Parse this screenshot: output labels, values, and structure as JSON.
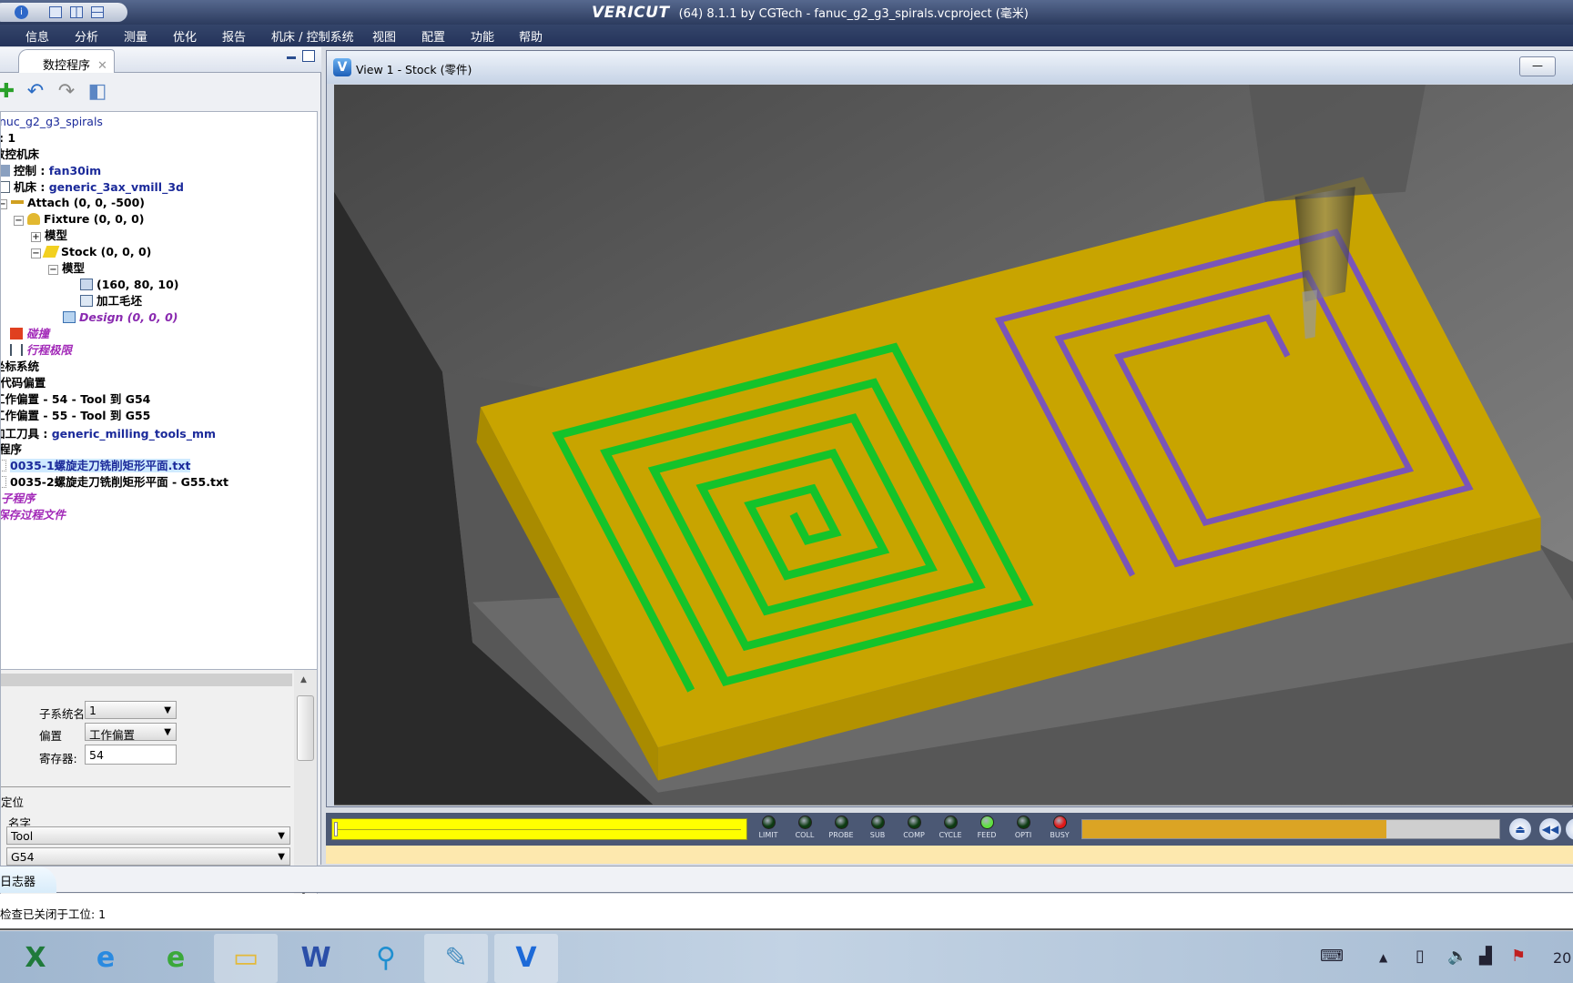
{
  "titlebar": {
    "logo": "VERICUT",
    "text": "(64)  8.1.1 by CGTech - fanuc_g2_g3_spirals.vcproject (毫米)"
  },
  "menu": [
    "信息",
    "分析",
    "测量",
    "优化",
    "报告",
    "机床 / 控制系统",
    "视图",
    "配置",
    "功能",
    "帮助"
  ],
  "left_panel": {
    "tab_label": "数控程序",
    "close_glyph": "✕",
    "tree": [
      {
        "text": "nuc_g2_g3_spirals",
        "style": "blue-plain"
      },
      {
        "text": ": 1"
      },
      {
        "text": "数控机床"
      },
      {
        "label": "控制 : ",
        "value": "fan30im"
      },
      {
        "label": "机床 : ",
        "value": "generic_3ax_vmill_3d"
      },
      {
        "text": "Attach (0, 0, -500)"
      },
      {
        "text": "Fixture (0, 0, 0)"
      },
      {
        "text": "模型"
      },
      {
        "text": "Stock (0, 0, 0)"
      },
      {
        "text": "模型"
      },
      {
        "text": "(160, 80, 10)"
      },
      {
        "text": "加工毛坯"
      },
      {
        "text": "Design (0, 0, 0)"
      },
      {
        "text": "碰撞"
      },
      {
        "text": "行程极限"
      },
      {
        "text": "坐标系统"
      },
      {
        "text": "-代码偏置"
      },
      {
        "label": "工作偏置",
        "value": " - 54 - Tool 到 G54"
      },
      {
        "label": "工作偏置",
        "value": " - 55 - Tool 到 G55"
      },
      {
        "label": "加工刀具 : ",
        "value": "generic_milling_tools_mm"
      },
      {
        "text": "程序"
      },
      {
        "text": "0035-1螺旋走刀铣削矩形平面.txt"
      },
      {
        "text": "0035-2螺旋走刀铣削矩形平面 - G55.txt"
      },
      {
        "text": "子程序"
      },
      {
        "text": "保存过程文件"
      }
    ],
    "props": {
      "subsystem_label": "子系统名",
      "subsystem_value": "1",
      "offset_label": "偏置",
      "offset_value": "工作偏置",
      "register_label": "寄存器:",
      "register_value": "54",
      "position_label": "定位",
      "name_label": "名字",
      "from_value": "Tool",
      "to_value": "G54"
    }
  },
  "view": {
    "logo": "V",
    "title": "View 1 - Stock (零件)",
    "minimize_glyph": "—"
  },
  "status": {
    "progress_percent": 0,
    "leds": [
      {
        "label": "LIMIT",
        "color": "#0d3a12"
      },
      {
        "label": "COLL",
        "color": "#0d3a12"
      },
      {
        "label": "PROBE",
        "color": "#0d3a12"
      },
      {
        "label": "SUB",
        "color": "#0d3a12"
      },
      {
        "label": "COMP",
        "color": "#0d3a12"
      },
      {
        "label": "CYCLE",
        "color": "#0d3a12"
      },
      {
        "label": "FEED",
        "color": "#5fe040"
      },
      {
        "label": "OPTI",
        "color": "#0d3a12"
      },
      {
        "label": "BUSY",
        "color": "#e01818"
      }
    ],
    "animation_speed_percent": 73,
    "buttons": [
      "eject-icon",
      "rewind-icon",
      "pause-icon"
    ]
  },
  "logger": {
    "tab_label": "日志器",
    "message": "检查已关闭于工位:  1"
  },
  "taskbar": {
    "apps": [
      {
        "name": "excel",
        "glyph": "X",
        "color": "#1f7a3a"
      },
      {
        "name": "internet-explorer",
        "glyph": "e",
        "color": "#2a8ae0"
      },
      {
        "name": "browser-green",
        "glyph": "e",
        "color": "#3aa83a"
      },
      {
        "name": "file-explorer",
        "glyph": "▭",
        "color": "#e3b93a"
      },
      {
        "name": "word",
        "glyph": "W",
        "color": "#2b4fa8"
      },
      {
        "name": "search-app",
        "glyph": "⚲",
        "color": "#1f8fd0"
      },
      {
        "name": "notepad",
        "glyph": "✎",
        "color": "#4a8fc0"
      },
      {
        "name": "vericut",
        "glyph": "V",
        "color": "#1d6ad8"
      }
    ],
    "clock_partial": "20"
  },
  "colors": {
    "stock": "#c8a400",
    "cut_green": "#14c32a",
    "cut_purple": "#7a55b8"
  }
}
